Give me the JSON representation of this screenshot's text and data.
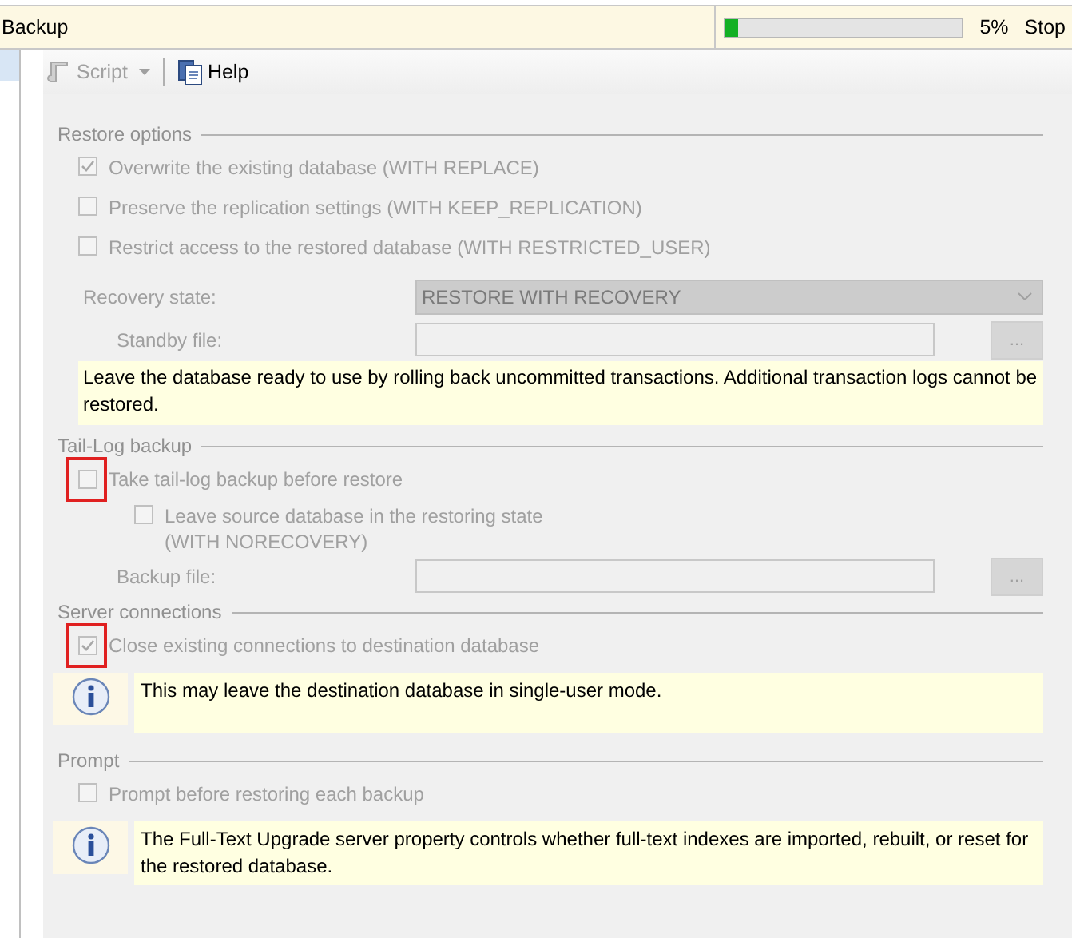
{
  "title_bar": {
    "title": "Backup",
    "progress": {
      "level": 0.05,
      "reading": "5%"
    },
    "stop": "Stop"
  },
  "toolbar": [
    {
      "kind": "script",
      "label": "Script",
      "disabled": true,
      "dropdown": true
    },
    {
      "kind": "help",
      "label": "Help",
      "disabled": false,
      "dropdown": false
    }
  ],
  "sections": [
    {
      "title": "Restore options",
      "items": [
        {
          "kind": "checkbox",
          "lines": [
            "Overwrite the existing database (WITH REPLACE)"
          ],
          "checked": true,
          "highlighted": false
        },
        {
          "kind": "checkbox",
          "lines": [
            "Preserve the replication settings (WITH KEEP_REPLICATION)"
          ],
          "checked": false,
          "highlighted": false
        },
        {
          "kind": "checkbox",
          "lines": [
            "Restrict access to the restored database (WITH RESTRICTED_USER)"
          ],
          "checked": false,
          "highlighted": false
        },
        {
          "kind": "select",
          "label": "Recovery state:",
          "value": "RESTORE WITH RECOVERY"
        },
        {
          "kind": "file",
          "label": "Standby file:",
          "button": "..."
        },
        {
          "kind": "note",
          "text": "Leave the database ready to use by rolling back uncommitted transactions. Additional transaction logs cannot be restored."
        }
      ]
    },
    {
      "title": "Tail-Log backup",
      "items": [
        {
          "kind": "checkbox",
          "lines": [
            "Take tail-log backup before restore"
          ],
          "checked": false,
          "highlighted": true,
          "children": [
            {
              "kind": "checkbox",
              "lines": [
                "Leave source database in the restoring state",
                "(WITH NORECOVERY)"
              ],
              "checked": false,
              "highlighted": false
            }
          ]
        },
        {
          "kind": "file",
          "label": "Backup file:",
          "button": "..."
        }
      ]
    },
    {
      "title": "Server connections",
      "items": [
        {
          "kind": "checkbox",
          "lines": [
            "Close existing connections to destination database"
          ],
          "checked": true,
          "highlighted": true
        },
        {
          "kind": "info",
          "text": "This may leave the destination database in single-user mode."
        }
      ]
    },
    {
      "title": "Prompt",
      "items": [
        {
          "kind": "checkbox",
          "lines": [
            "Prompt before restoring each backup"
          ],
          "checked": false,
          "highlighted": false
        },
        {
          "kind": "info",
          "text": "The Full-Text Upgrade server property controls whether full-text indexes are imported, rebuilt, or reset for the restored database."
        }
      ]
    }
  ]
}
